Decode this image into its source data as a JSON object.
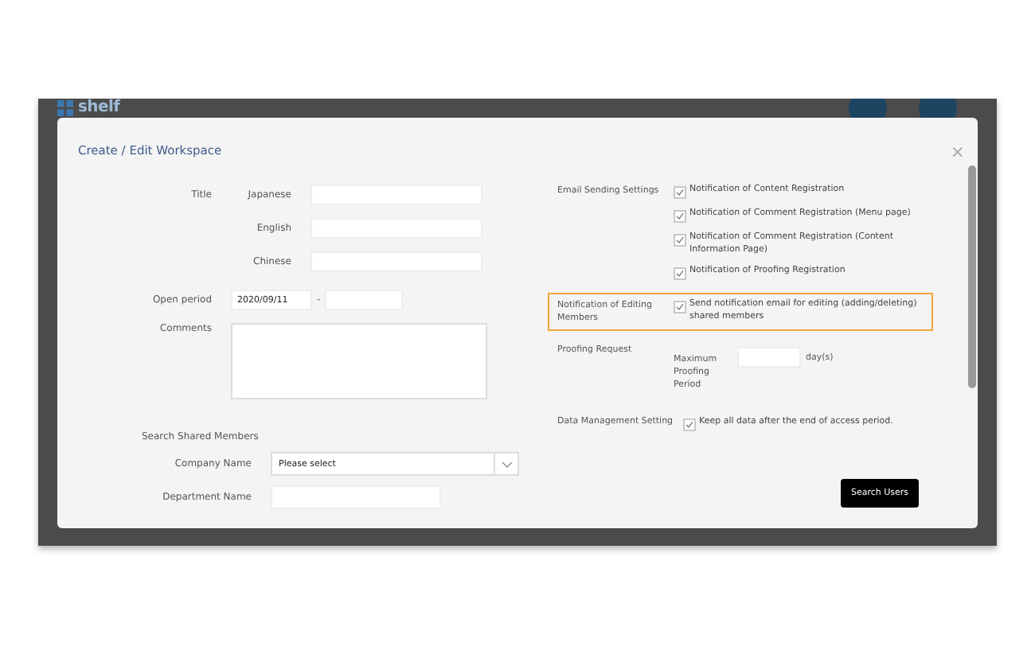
{
  "app": {
    "logo": "shelf"
  },
  "dialog": {
    "title": "Create / Edit Workspace",
    "close": "×",
    "title_group": {
      "label": "Title",
      "fields": [
        {
          "label": "Japanese"
        },
        {
          "label": "English"
        },
        {
          "label": "Chinese"
        }
      ]
    },
    "open_period": {
      "label": "Open period",
      "start": "2020/09/11",
      "separator": "-"
    },
    "comments": {
      "label": "Comments"
    },
    "search_members": {
      "heading": "Search Shared Members",
      "company": {
        "label": "Company Name",
        "value": "Please select"
      },
      "department": {
        "label": "Department Name"
      }
    },
    "email_settings": {
      "label": "Email Sending Settings",
      "options": [
        {
          "label": "Notification of Content Registration",
          "checked": true
        },
        {
          "label": "Notification of Comment Registration (Menu page)",
          "checked": true
        },
        {
          "label": "Notification of Comment Registration (Content Information Page)",
          "checked": true
        },
        {
          "label": "Notification of Proofing Registration",
          "checked": true
        }
      ]
    },
    "editing_members": {
      "label": "Notification of Editing Members",
      "highlighted": true,
      "option": {
        "label": "Send notification email for editing (adding/deleting) shared members",
        "checked": true
      }
    },
    "proofing": {
      "label": "Proofing Request",
      "field_label": "Maximum Proofing Period",
      "unit": "day(s)"
    },
    "data_management": {
      "label": "Data Management Setting",
      "option": {
        "label": "Keep all data after the end of access period.",
        "checked": true
      }
    },
    "search_button": "Search Users"
  }
}
